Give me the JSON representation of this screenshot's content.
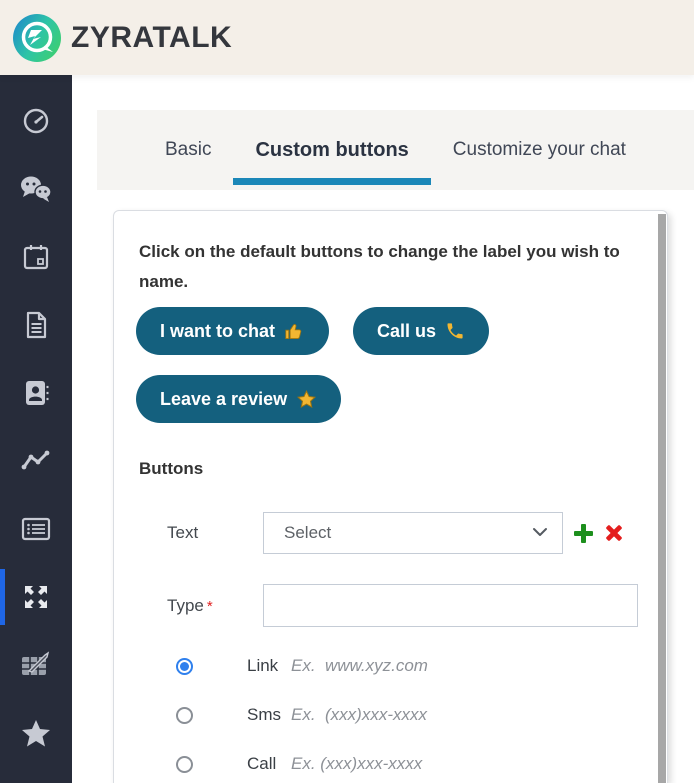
{
  "header": {
    "brand": "ZYRATALK"
  },
  "sidebar": {
    "items": [
      {
        "icon": "gauge-icon"
      },
      {
        "icon": "chat-bubbles-icon"
      },
      {
        "icon": "calendar-icon"
      },
      {
        "icon": "document-icon"
      },
      {
        "icon": "address-book-icon"
      },
      {
        "icon": "line-chart-icon"
      },
      {
        "icon": "list-card-icon"
      },
      {
        "icon": "expand-arrows-icon",
        "active": true
      },
      {
        "icon": "table-edit-icon"
      },
      {
        "icon": "star-icon"
      }
    ]
  },
  "tabs": [
    {
      "label": "Basic",
      "active": false
    },
    {
      "label": "Custom buttons",
      "active": true
    },
    {
      "label": "Customize your chat",
      "active": false
    }
  ],
  "panel": {
    "instruction": "Click on the default buttons to change the label you wish to name.",
    "default_buttons": [
      {
        "label": "I want to chat",
        "icon": "thumbs-up-icon"
      },
      {
        "label": "Call us",
        "icon": "phone-icon"
      },
      {
        "label": "Leave a review",
        "icon": "star-icon"
      }
    ],
    "section_title": "Buttons",
    "form": {
      "text_label": "Text",
      "select_value": "Select",
      "add_icon": "plus-icon",
      "remove_icon": "cross-icon",
      "type_label": "Type",
      "required_mark": "*",
      "type_value": "",
      "radio_options": [
        {
          "label": "Link",
          "example": "Ex.  www.xyz.com",
          "selected": true
        },
        {
          "label": "Sms",
          "example": "Ex.  (xxx)xxx-xxxx",
          "selected": false
        },
        {
          "label": "Call",
          "example": "Ex. (xxx)xxx-xxxx",
          "selected": false
        }
      ]
    }
  },
  "colors": {
    "header_bg": "#f4efe8",
    "sidebar_bg": "#272c3a",
    "active_indicator": "#1f66e5",
    "tab_underline": "#1b87b8",
    "button_teal": "#14607e",
    "emoji_gold": "#f2b632",
    "plus_green": "#1d8f1d",
    "cross_red": "#e41e1e",
    "radio_blue": "#2f80ed"
  }
}
